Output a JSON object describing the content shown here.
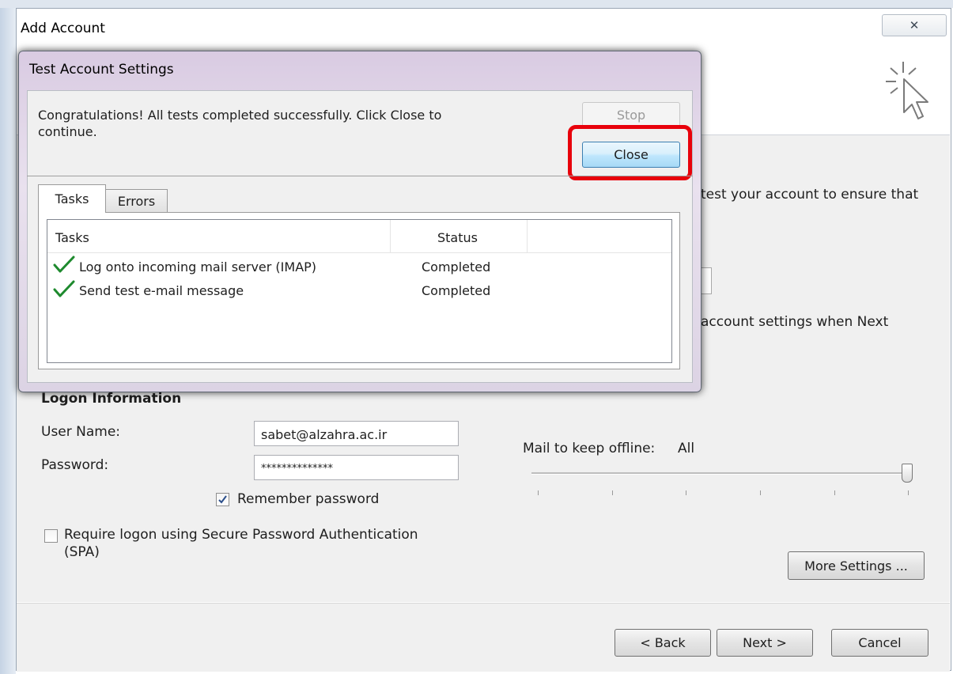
{
  "main_window": {
    "title": "Add Account",
    "close_glyph": "✕"
  },
  "background_fragments": {
    "test_description": "test your account to ensure that",
    "auto_test": "account settings when Next"
  },
  "logon": {
    "heading": "Logon Information",
    "username_label": "User Name:",
    "username_value": "sabet@alzahra.ac.ir",
    "password_label": "Password:",
    "password_value": "**************",
    "remember_label": "Remember password",
    "remember_checked": true,
    "spa_label_line1": "Require logon using Secure Password Authentication",
    "spa_label_line2": "(SPA)",
    "spa_checked": false
  },
  "offline": {
    "label": "Mail to keep offline:",
    "value": "All",
    "level_fraction": 1.0
  },
  "buttons": {
    "more_settings": "More Settings ...",
    "back": "< Back",
    "next": "Next >",
    "cancel": "Cancel"
  },
  "test_dialog": {
    "title": "Test Account Settings",
    "message_line1": "Congratulations! All tests completed successfully. Click Close to",
    "message_line2": "continue.",
    "stop_label": "Stop",
    "close_label": "Close",
    "highlight_color": "#e8000b",
    "tabs": [
      {
        "label": "Tasks",
        "active": true
      },
      {
        "label": "Errors",
        "active": false
      }
    ],
    "columns": [
      "Tasks",
      "Status"
    ],
    "rows": [
      {
        "task": "Log onto incoming mail server (IMAP)",
        "status": "Completed",
        "icon": "green-check-icon"
      },
      {
        "task": "Send test e-mail message",
        "status": "Completed",
        "icon": "green-check-icon"
      }
    ]
  }
}
